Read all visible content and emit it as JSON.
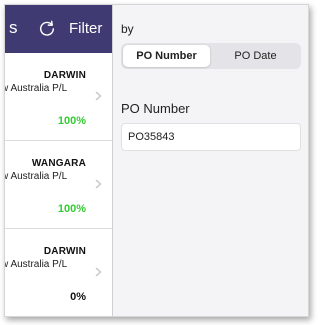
{
  "nav": {
    "back_text": "s",
    "refresh_icon": "refresh-icon",
    "filter_label": "Filter"
  },
  "orders": [
    {
      "location": "DARWIN",
      "company": "w Australia P/L",
      "percent": "100%",
      "percent_color": "#33cc33"
    },
    {
      "location": "WANGARA",
      "company": "w Australia P/L",
      "percent": "100%",
      "percent_color": "#33cc33"
    },
    {
      "location": "DARWIN",
      "company": "w Australia P/L",
      "percent": "0%",
      "percent_color": "#111111"
    }
  ],
  "filter_panel": {
    "by_label": "by",
    "segments": [
      "PO Number",
      "PO Date"
    ],
    "selected_segment": "PO Number",
    "field_label": "PO Number",
    "field_value": "PO35843"
  },
  "colors": {
    "nav_bar": "#3f3a72",
    "complete_green": "#33cc33"
  }
}
